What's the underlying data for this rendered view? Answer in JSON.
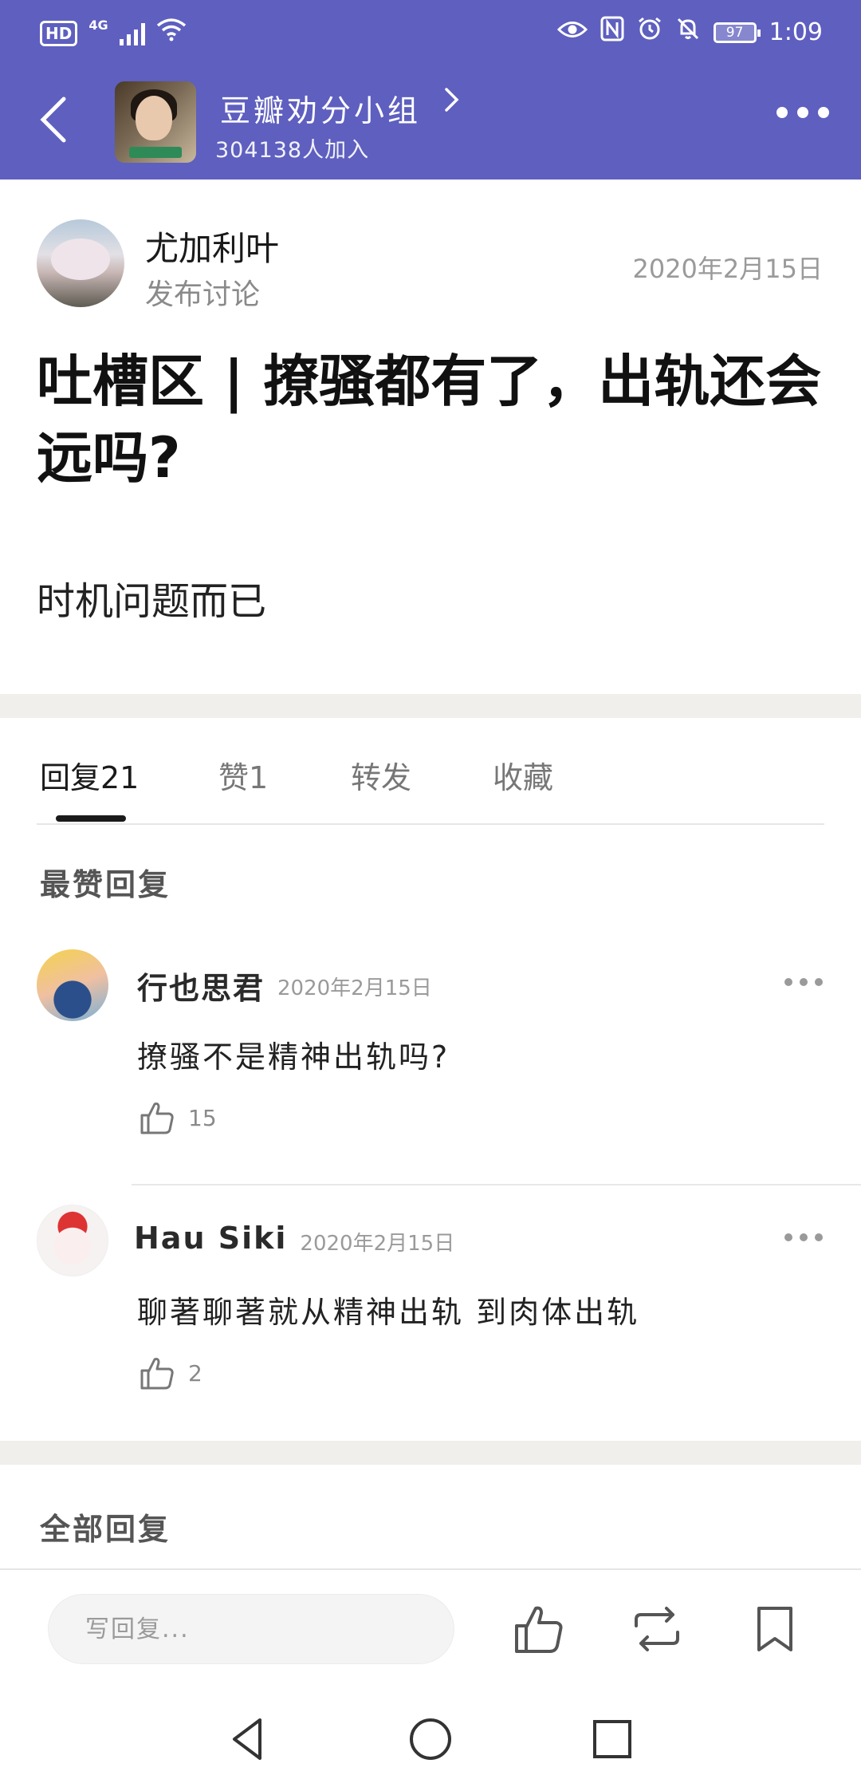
{
  "status_bar": {
    "hd": "HD",
    "network": "4G",
    "battery": "97",
    "time": "1:09"
  },
  "header": {
    "group_name": "豆瓣劝分小组",
    "member_count": "304138人加入",
    "accent_color": "#5e5fbf"
  },
  "post": {
    "author": "尤加利叶",
    "action": "发布讨论",
    "date": "2020年2月15日",
    "title": "吐槽区 | 撩骚都有了，出轨还会远吗?",
    "body": "时机问题而已"
  },
  "tabs": [
    {
      "label": "回复21",
      "active": true
    },
    {
      "label": "赞1",
      "active": false
    },
    {
      "label": "转发",
      "active": false
    },
    {
      "label": "收藏",
      "active": false
    }
  ],
  "sections": {
    "top_replies": "最赞回复",
    "all_replies": "全部回复"
  },
  "comments": [
    {
      "author": "行也思君",
      "date": "2020年2月15日",
      "text": "撩骚不是精神出轨吗?",
      "likes": "15"
    },
    {
      "author": "Hau Siki",
      "date": "2020年2月15日",
      "text": "聊著聊著就从精神出轨 到肉体出轨",
      "likes": "2"
    }
  ],
  "bottom_bar": {
    "reply_placeholder": "写回复..."
  },
  "icons": {
    "back": "chevron-left-icon",
    "more": "more-dots-icon",
    "like": "thumbs-up-icon",
    "repost": "repost-icon",
    "bookmark": "bookmark-icon"
  }
}
